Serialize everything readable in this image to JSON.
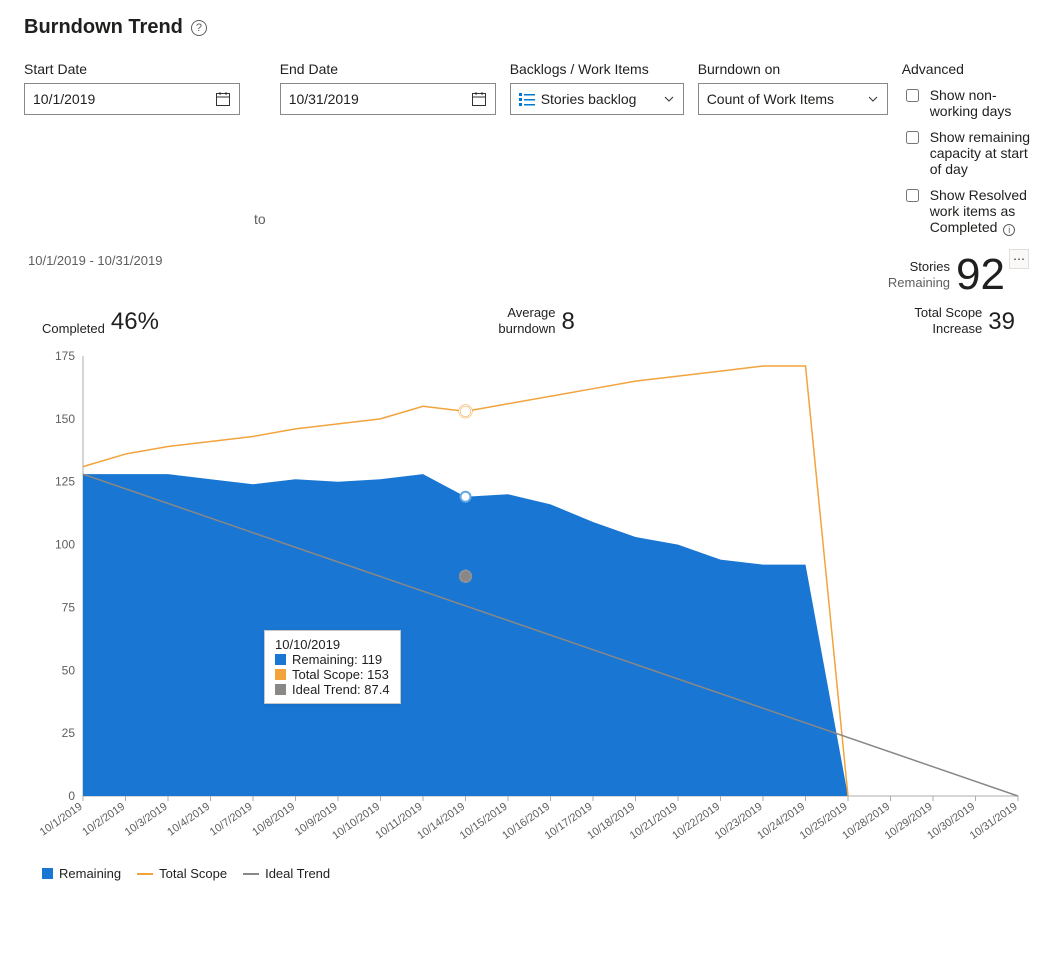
{
  "page": {
    "title": "Burndown Trend"
  },
  "filters": {
    "start_date": {
      "label": "Start Date",
      "value": "10/1/2019"
    },
    "to_label": "to",
    "end_date": {
      "label": "End Date",
      "value": "10/31/2019"
    },
    "backlogs": {
      "label": "Backlogs / Work Items",
      "value": "Stories backlog"
    },
    "burndown_on": {
      "label": "Burndown on",
      "value": "Count of Work Items"
    }
  },
  "advanced": {
    "label": "Advanced",
    "opts": {
      "nonworking": {
        "label": "Show non-working days",
        "checked": false
      },
      "capacity": {
        "label": "Show remaining capacity at start of day",
        "checked": false
      },
      "resolved": {
        "label": "Show Resolved work items as Completed",
        "checked": false
      }
    }
  },
  "summary": {
    "date_range": "10/1/2019 - 10/31/2019",
    "stories_label": "Stories",
    "remaining_label": "Remaining",
    "stories_value": "92",
    "completed_label": "Completed",
    "completed_value": "46%",
    "avg_label1": "Average",
    "avg_label2": "burndown",
    "avg_value": "8",
    "scope_label1": "Total Scope",
    "scope_label2": "Increase",
    "scope_value": "39"
  },
  "tooltip": {
    "date": "10/10/2019",
    "rows": {
      "remaining": "Remaining: 119",
      "scope": "Total Scope: 153",
      "ideal": "Ideal Trend: 87.4"
    }
  },
  "legend": {
    "remaining": "Remaining",
    "scope": "Total Scope",
    "ideal": "Ideal Trend"
  },
  "chart_data": {
    "type": "area+line",
    "ylim": [
      0,
      175
    ],
    "y_ticks": [
      0,
      25,
      50,
      75,
      100,
      125,
      150,
      175
    ],
    "categories": [
      "10/1/2019",
      "10/2/2019",
      "10/3/2019",
      "10/4/2019",
      "10/7/2019",
      "10/8/2019",
      "10/9/2019",
      "10/10/2019",
      "10/11/2019",
      "10/14/2019",
      "10/15/2019",
      "10/16/2019",
      "10/17/2019",
      "10/18/2019",
      "10/21/2019",
      "10/22/2019",
      "10/23/2019",
      "10/24/2019",
      "10/25/2019",
      "10/28/2019",
      "10/29/2019",
      "10/30/2019",
      "10/31/2019"
    ],
    "series": [
      {
        "name": "Remaining",
        "kind": "area",
        "color": "#1976d2",
        "values": [
          128,
          128,
          128,
          126,
          124,
          126,
          125,
          126,
          128,
          119,
          120,
          116,
          109,
          103,
          100,
          94,
          92,
          92,
          0,
          null,
          null,
          null,
          null,
          null
        ]
      },
      {
        "name": "Total Scope",
        "kind": "line",
        "color": "#f2a33c",
        "values": [
          131,
          136,
          139,
          141,
          143,
          146,
          148,
          150,
          155,
          153,
          156,
          159,
          162,
          165,
          167,
          169,
          171,
          171,
          0,
          null,
          null,
          null,
          null,
          null
        ]
      },
      {
        "name": "Ideal Trend",
        "kind": "line",
        "color": "#8a8886",
        "values": [
          128,
          null,
          null,
          null,
          null,
          null,
          null,
          null,
          null,
          null,
          null,
          null,
          null,
          null,
          null,
          null,
          null,
          null,
          null,
          null,
          null,
          null,
          0
        ],
        "endpoints": {
          "x0": 0,
          "y0": 128,
          "x1": 22,
          "y1": 0
        }
      }
    ],
    "hover_index": 9,
    "hover": {
      "date": "10/10/2019",
      "Remaining": 119,
      "Total Scope": 153,
      "Ideal Trend": 87.4
    }
  }
}
